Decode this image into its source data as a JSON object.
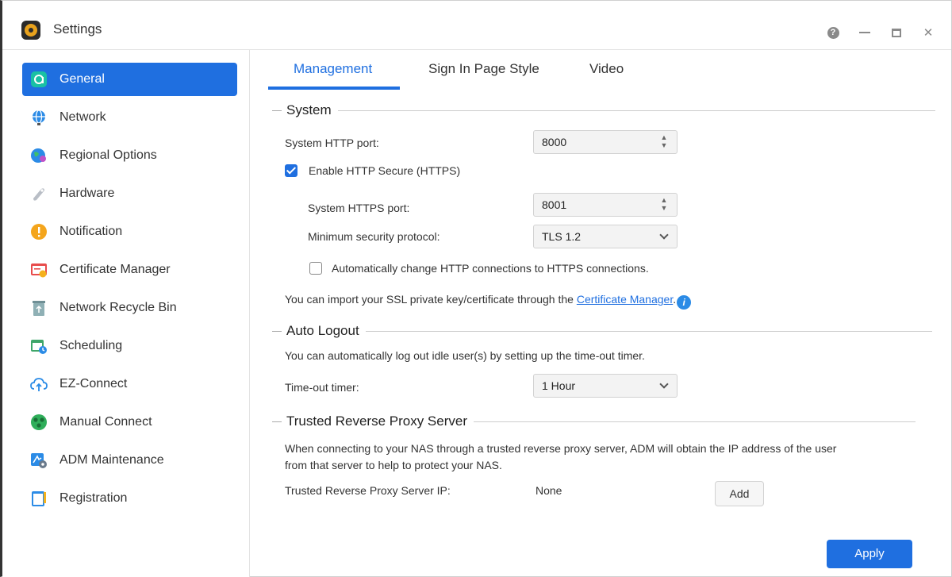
{
  "window": {
    "title": "Settings",
    "accent_color": "#1f6fe0",
    "controls": {
      "help_glyph": "?",
      "close_glyph": "✕"
    }
  },
  "sidebar": {
    "items": [
      {
        "label": "General",
        "icon": "general-icon",
        "active": true
      },
      {
        "label": "Network",
        "icon": "globe-icon"
      },
      {
        "label": "Regional Options",
        "icon": "regional-globe-icon"
      },
      {
        "label": "Hardware",
        "icon": "hardware-icon"
      },
      {
        "label": "Notification",
        "icon": "alert-icon"
      },
      {
        "label": "Certificate Manager",
        "icon": "certificate-icon"
      },
      {
        "label": "Network Recycle Bin",
        "icon": "recycle-bin-icon"
      },
      {
        "label": "Scheduling",
        "icon": "calendar-clock-icon"
      },
      {
        "label": "EZ-Connect",
        "icon": "cloud-upload-icon"
      },
      {
        "label": "Manual Connect",
        "icon": "manual-connect-icon"
      },
      {
        "label": "ADM Maintenance",
        "icon": "maintenance-icon"
      },
      {
        "label": "Registration",
        "icon": "registration-icon"
      }
    ]
  },
  "tabs": [
    {
      "label": "Management",
      "active": true
    },
    {
      "label": "Sign In Page Style"
    },
    {
      "label": "Video"
    }
  ],
  "system": {
    "title": "System",
    "http_port_label": "System HTTP port:",
    "http_port_value": "8000",
    "https_enable_label": "Enable HTTP Secure (HTTPS)",
    "https_enabled": true,
    "https_port_label": "System HTTPS port:",
    "https_port_value": "8001",
    "min_protocol_label": "Minimum security protocol:",
    "min_protocol_value": "TLS 1.2",
    "auto_redirect_label": "Automatically change HTTP connections to HTTPS connections.",
    "auto_redirect_checked": false,
    "ssl_note_prefix": "You can import your SSL private key/certificate through the ",
    "ssl_note_link": "Certificate Manager",
    "ssl_note_suffix": ".",
    "info_glyph": "i"
  },
  "auto_logout": {
    "title": "Auto Logout",
    "description": "You can automatically log out idle user(s) by setting up the time-out timer.",
    "timer_label": "Time-out timer:",
    "timer_value": "1 Hour"
  },
  "proxy": {
    "title": "Trusted Reverse Proxy Server",
    "description_line1": "When connecting to your NAS through a trusted reverse proxy server, ADM will obtain the IP address of the user",
    "description_line2": "from that server to help to protect your NAS.",
    "ip_label": "Trusted Reverse Proxy Server IP:",
    "ip_value": "None",
    "add_label": "Add"
  },
  "footer": {
    "apply_label": "Apply"
  }
}
